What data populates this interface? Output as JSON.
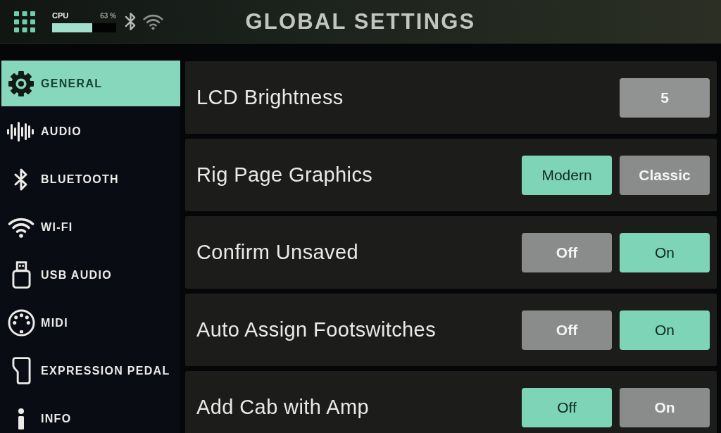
{
  "header": {
    "title": "GLOBAL SETTINGS",
    "cpu": {
      "label": "CPU",
      "reading": "63 %",
      "level": 0.63
    }
  },
  "sidebar": {
    "items": [
      {
        "label": "GENERAL",
        "selected": true
      },
      {
        "label": "AUDIO",
        "selected": false
      },
      {
        "label": "BLUETOOTH",
        "selected": false
      },
      {
        "label": "WI-FI",
        "selected": false
      },
      {
        "label": "USB AUDIO",
        "selected": false
      },
      {
        "label": "MIDI",
        "selected": false
      },
      {
        "label": "EXPRESSION PEDAL",
        "selected": false
      },
      {
        "label": "INFO",
        "selected": false
      }
    ]
  },
  "settings": [
    {
      "label": "LCD Brightness",
      "kind": "value",
      "value": "5"
    },
    {
      "label": "Rig Page Graphics",
      "kind": "choice",
      "options": [
        {
          "label": "Modern",
          "selected": true
        },
        {
          "label": "Classic",
          "selected": false
        }
      ]
    },
    {
      "label": "Confirm Unsaved",
      "kind": "choice",
      "options": [
        {
          "label": "Off",
          "selected": false
        },
        {
          "label": "On",
          "selected": true
        }
      ]
    },
    {
      "label": "Auto Assign Footswitches",
      "kind": "choice",
      "options": [
        {
          "label": "Off",
          "selected": false
        },
        {
          "label": "On",
          "selected": true
        }
      ]
    },
    {
      "label": "Add Cab with Amp",
      "kind": "choice",
      "options": [
        {
          "label": "Off",
          "selected": true
        },
        {
          "label": "On",
          "selected": false
        }
      ]
    }
  ]
}
